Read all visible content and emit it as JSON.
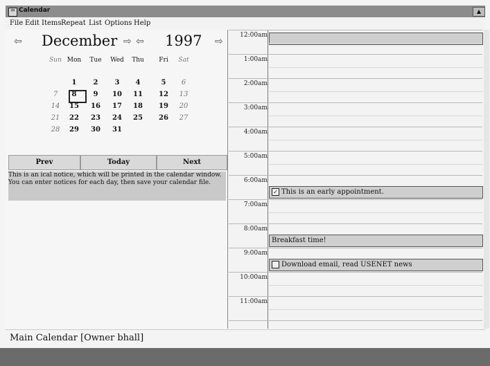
{
  "window": {
    "title": "Calendar",
    "sys_glyph": "=",
    "btn_glyph": "▲"
  },
  "menu": [
    "File",
    "Edit",
    "Items",
    "Repeat",
    "List",
    "Options",
    "Help"
  ],
  "calendar": {
    "month": "December",
    "year": "1997",
    "arrow_left": "⇦",
    "arrow_right": "⇨",
    "weekdays": [
      "Sun",
      "Mon",
      "Tue",
      "Wed",
      "Thu",
      "Fri",
      "Sat"
    ],
    "weeks": [
      [
        "",
        "1",
        "2",
        "3",
        "4",
        "5",
        "6"
      ],
      [
        "7",
        "8",
        "9",
        "10",
        "11",
        "12",
        "13"
      ],
      [
        "14",
        "15",
        "16",
        "17",
        "18",
        "19",
        "20"
      ],
      [
        "21",
        "22",
        "23",
        "24",
        "25",
        "26",
        "27"
      ],
      [
        "28",
        "29",
        "30",
        "31",
        "",
        "",
        ""
      ]
    ],
    "selected_day": "8"
  },
  "buttons": {
    "prev": "Prev",
    "today": "Today",
    "next": "Next"
  },
  "notice": "This is an ical notice, which will be printed in the calendar window. You can enter notices for each day, then save your calendar file.",
  "schedule": {
    "hours": [
      "12:00am",
      "1:00am",
      "2:00am",
      "3:00am",
      "4:00am",
      "5:00am",
      "6:00am",
      "7:00am",
      "8:00am",
      "9:00am",
      "10:00am",
      "11:00am"
    ],
    "appointments": [
      {
        "hour": "6:00am",
        "text": "This is an early appointment.",
        "checked": true,
        "check": "✓"
      },
      {
        "hour": "8:00am",
        "text": "Breakfast time!",
        "checked": false,
        "check": ""
      },
      {
        "hour": "9:00am",
        "text": "Download email, read USENET news",
        "checked": false,
        "check": ""
      }
    ]
  },
  "status": "Main Calendar [Owner bhall]"
}
